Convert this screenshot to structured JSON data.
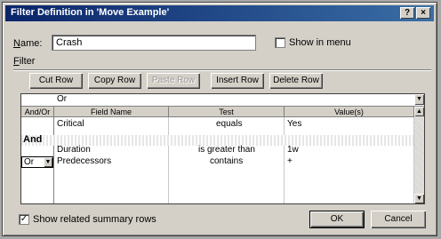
{
  "window": {
    "title": "Filter Definition in 'Move Example'",
    "help_label": "?",
    "close_label": "×"
  },
  "name_field": {
    "label_accel": "N",
    "label_rest": "ame:",
    "value": "Crash"
  },
  "show_in_menu": {
    "label": "Show in menu",
    "checked": false
  },
  "filter_section": {
    "label_accel": "F",
    "label_rest": "ilter"
  },
  "toolbar": {
    "cut_row": "Cut Row",
    "copy_row": "Copy Row",
    "paste_row": "Paste Row",
    "insert_row": "Insert Row",
    "delete_row": "Delete Row"
  },
  "edit_box": {
    "value": "Or"
  },
  "table": {
    "columns": [
      "And/Or",
      "Field Name",
      "Test",
      "Value(s)"
    ],
    "rows": [
      {
        "and_or": "",
        "field": "Critical",
        "test": "equals",
        "value": "Yes"
      },
      {
        "and_or": "And",
        "field": "",
        "test": "",
        "value": ""
      },
      {
        "and_or": "",
        "field": "Duration",
        "test": "is greater than",
        "value": "1w"
      },
      {
        "and_or": "Or",
        "field": "Predecessors",
        "test": "contains",
        "value": "+"
      }
    ]
  },
  "show_summary_rows": {
    "label": "Show related summary rows",
    "checked": true,
    "check_glyph": "✓"
  },
  "buttons": {
    "ok": "OK",
    "cancel": "Cancel"
  },
  "glyphs": {
    "dropdown": "▼",
    "scroll_up": "▲",
    "scroll_down": "▼"
  }
}
